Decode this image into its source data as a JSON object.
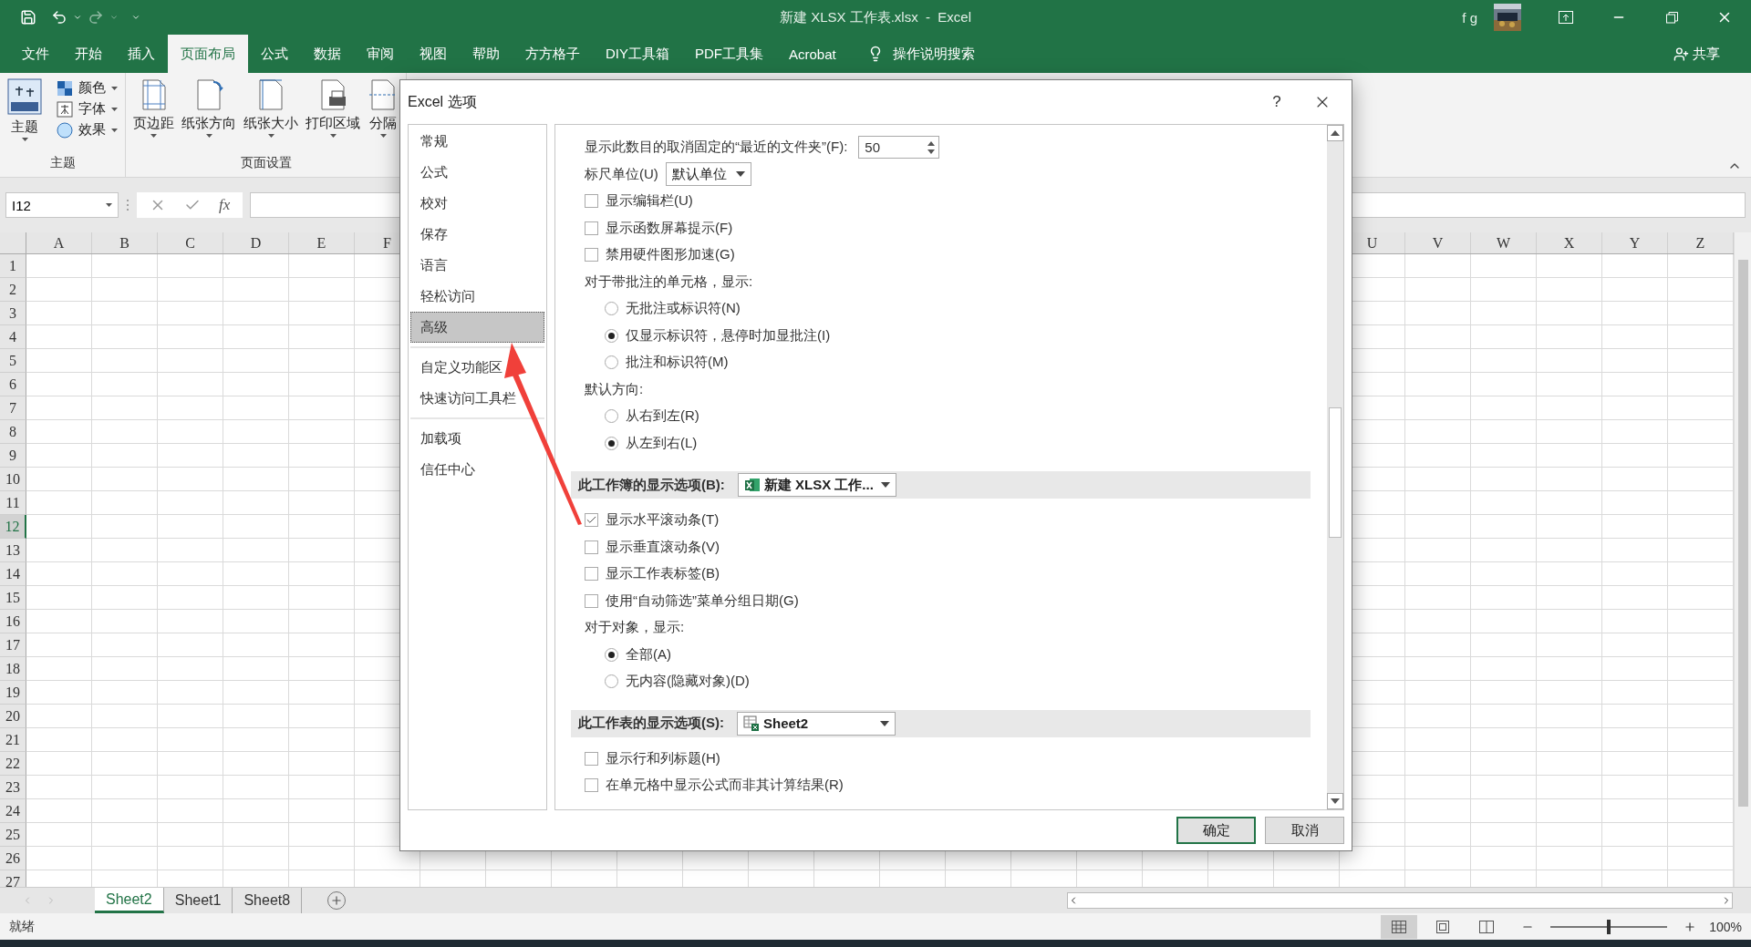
{
  "title_bar": {
    "title": "新建 XLSX 工作表.xlsx  -  Excel",
    "user": "f g"
  },
  "menu_tabs": [
    {
      "label": "文件",
      "selected": false
    },
    {
      "label": "开始",
      "selected": false
    },
    {
      "label": "插入",
      "selected": false
    },
    {
      "label": "页面布局",
      "selected": true
    },
    {
      "label": "公式",
      "selected": false
    },
    {
      "label": "数据",
      "selected": false
    },
    {
      "label": "审阅",
      "selected": false
    },
    {
      "label": "视图",
      "selected": false
    },
    {
      "label": "帮助",
      "selected": false
    },
    {
      "label": "方方格子",
      "selected": false
    },
    {
      "label": "DIY工具箱",
      "selected": false
    },
    {
      "label": "PDF工具集",
      "selected": false
    },
    {
      "label": "Acrobat",
      "selected": false
    }
  ],
  "tell_me": "操作说明搜索",
  "share": "共享",
  "ribbon": {
    "groups": [
      {
        "label": "主题",
        "large": [
          "主题"
        ],
        "small": [
          "颜色",
          "字体",
          "效果"
        ]
      },
      {
        "label": "页面设置",
        "large": [
          "页边距",
          "纸张方向",
          "纸张大小",
          "打印区域",
          "分隔"
        ]
      }
    ]
  },
  "formula_bar": {
    "name_box": "I12",
    "function_label": "fx"
  },
  "columns_left": [
    "A",
    "B",
    "C",
    "D",
    "E",
    "F"
  ],
  "columns_right": [
    "U",
    "V",
    "W",
    "X",
    "Y",
    "Z"
  ],
  "rows": [
    {
      "label": "1",
      "selected": false
    },
    {
      "label": "2",
      "selected": false
    },
    {
      "label": "3",
      "selected": false
    },
    {
      "label": "4",
      "selected": false
    },
    {
      "label": "5",
      "selected": false
    },
    {
      "label": "6",
      "selected": false
    },
    {
      "label": "7",
      "selected": false
    },
    {
      "label": "8",
      "selected": false
    },
    {
      "label": "9",
      "selected": false
    },
    {
      "label": "10",
      "selected": false
    },
    {
      "label": "11",
      "selected": false
    },
    {
      "label": "12",
      "selected": true
    },
    {
      "label": "13",
      "selected": false
    },
    {
      "label": "14",
      "selected": false
    },
    {
      "label": "15",
      "selected": false
    },
    {
      "label": "16",
      "selected": false
    },
    {
      "label": "17",
      "selected": false
    },
    {
      "label": "18",
      "selected": false
    },
    {
      "label": "19",
      "selected": false
    },
    {
      "label": "20",
      "selected": false
    },
    {
      "label": "21",
      "selected": false
    },
    {
      "label": "22",
      "selected": false
    },
    {
      "label": "23",
      "selected": false
    },
    {
      "label": "24",
      "selected": false
    },
    {
      "label": "25",
      "selected": false
    },
    {
      "label": "26",
      "selected": false
    },
    {
      "label": "27",
      "selected": false
    }
  ],
  "sheet_tabs": [
    {
      "label": "Sheet2",
      "selected": true
    },
    {
      "label": "Sheet1",
      "selected": false
    },
    {
      "label": "Sheet8",
      "selected": false
    }
  ],
  "status_bar": {
    "status": "就绪",
    "zoom": "100%",
    "level": 0.5
  },
  "dialog": {
    "title": "Excel 选项",
    "help": "?",
    "nav_groups": [
      {
        "items": [
          {
            "label": "常规",
            "selected": false
          },
          {
            "label": "公式",
            "selected": false
          },
          {
            "label": "校对",
            "selected": false
          },
          {
            "label": "保存",
            "selected": false
          },
          {
            "label": "语言",
            "selected": false
          },
          {
            "label": "轻松访问",
            "selected": false
          },
          {
            "label": "高级",
            "selected": true
          }
        ]
      },
      {
        "items": [
          {
            "label": "自定义功能区",
            "selected": false
          },
          {
            "label": "快速访问工具栏",
            "selected": false
          }
        ]
      },
      {
        "items": [
          {
            "label": "加载项",
            "selected": false
          },
          {
            "label": "信任中心",
            "selected": false
          }
        ]
      }
    ],
    "settings": [
      {
        "kind": "spinner",
        "label": "显示此数目的取消固定的“最近的文件夹”(F):",
        "value": "50"
      },
      {
        "kind": "dropdown",
        "label": "标尺单位(U)",
        "value": "默认单位"
      },
      {
        "kind": "checkbox",
        "label": "显示编辑栏(U)",
        "checked": false
      },
      {
        "kind": "checkbox",
        "label": "显示函数屏幕提示(F)",
        "checked": false
      },
      {
        "kind": "checkbox",
        "label": "禁用硬件图形加速(G)",
        "checked": false
      },
      {
        "kind": "label",
        "label": "对于带批注的单元格，显示:"
      },
      {
        "kind": "radio",
        "label": "无批注或标识符(N)",
        "selected": false
      },
      {
        "kind": "radio",
        "label": "仅显示标识符，悬停时加显批注(I)",
        "selected": true
      },
      {
        "kind": "radio",
        "label": "批注和标识符(M)",
        "selected": false
      },
      {
        "kind": "label",
        "label": "默认方向:"
      },
      {
        "kind": "radio",
        "label": "从右到左(R)",
        "selected": false
      },
      {
        "kind": "radio",
        "label": "从左到右(L)",
        "selected": true
      },
      {
        "kind": "workbook-section",
        "label": "此工作簿的显示选项(B):",
        "value": "新建 XLSX 工作..."
      },
      {
        "kind": "checkbox",
        "label": "显示水平滚动条(T)",
        "checked": true
      },
      {
        "kind": "checkbox",
        "label": "显示垂直滚动条(V)",
        "checked": false
      },
      {
        "kind": "checkbox",
        "label": "显示工作表标签(B)",
        "checked": false
      },
      {
        "kind": "checkbox",
        "label": "使用“自动筛选”菜单分组日期(G)",
        "checked": false
      },
      {
        "kind": "label",
        "label": "对于对象，显示:"
      },
      {
        "kind": "radio",
        "label": "全部(A)",
        "selected": true
      },
      {
        "kind": "radio",
        "label": "无内容(隐藏对象)(D)",
        "selected": false
      },
      {
        "kind": "sheet-section",
        "label": "此工作表的显示选项(S):",
        "value": "Sheet2"
      },
      {
        "kind": "checkbox",
        "label": "显示行和列标题(H)",
        "checked": false
      },
      {
        "kind": "checkbox",
        "label": "在单元格中显示公式而非其计算结果(R)",
        "checked": false
      }
    ],
    "buttons": [
      {
        "label": "确定",
        "selected": true
      },
      {
        "label": "取消",
        "selected": false
      }
    ]
  }
}
